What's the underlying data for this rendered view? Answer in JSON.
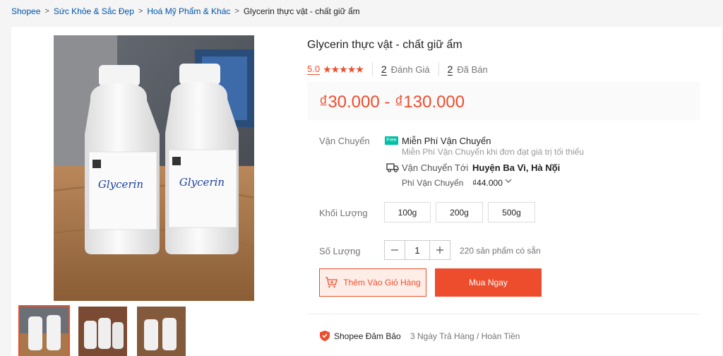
{
  "breadcrumb": [
    "Shopee",
    "Sức Khỏe & Sắc Đẹp",
    "Hoá Mỹ Phẩm & Khác",
    "Glycerin thực vật - chất giữ ẩm"
  ],
  "product": {
    "title": "Glycerin thực vật - chất giữ ẩm",
    "rating": "5.0",
    "stars": "★★★★★",
    "review_count": "2",
    "review_label": "Đánh Giá",
    "sold_count": "2",
    "sold_label": "Đã Bán",
    "price": "₫30.000 - ₫130.000"
  },
  "shipping": {
    "label": "Vận Chuyển",
    "free_badge": "Free",
    "free_title": "Miễn Phí Vận Chuyển",
    "free_desc": "Miễn Phí Vận Chuyển khi đơn đạt giá trị tối thiểu",
    "to_label": "Vận Chuyển Tới",
    "to_value": "Huyện Ba Vì, Hà Nội",
    "fee_label": "Phí Vận Chuyển",
    "fee_value": "₫44.000"
  },
  "variants": {
    "label": "Khối Lượng",
    "options": [
      "100g",
      "200g",
      "500g"
    ]
  },
  "quantity": {
    "label": "Số Lượng",
    "value": "1",
    "stock": "220 sản phẩm có sẵn"
  },
  "buttons": {
    "add_to_cart": "Thêm Vào Giỏ Hàng",
    "buy_now": "Mua Ngay"
  },
  "guarantee": {
    "title": "Shopee Đảm Bảo",
    "desc": "3 Ngày Trả Hàng / Hoàn Tiền"
  },
  "image_label": "Glycerin",
  "colors": {
    "accent": "#ee4d2d",
    "free": "#00bfa5"
  }
}
